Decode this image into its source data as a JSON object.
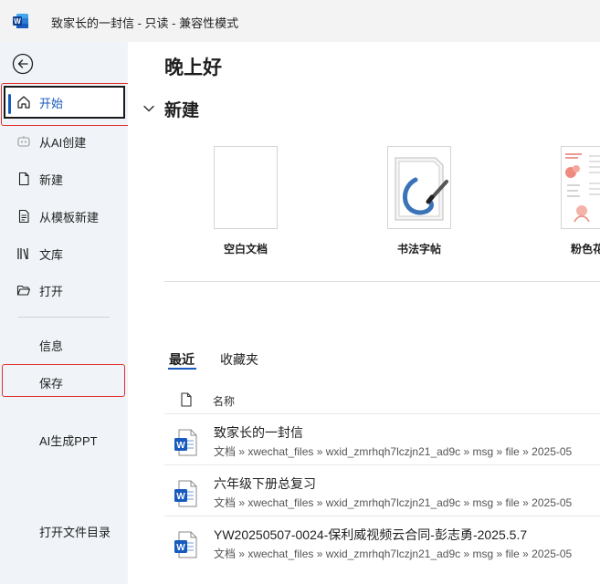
{
  "titlebar": {
    "title": "致家长的一封信  -  只读  -  兼容性模式"
  },
  "sidebar": {
    "items": [
      {
        "label": "开始",
        "icon": "home-icon"
      },
      {
        "label": "从AI创建",
        "icon": "ai-create-icon"
      },
      {
        "label": "新建",
        "icon": "new-document-icon"
      },
      {
        "label": "从模板新建",
        "icon": "template-icon"
      },
      {
        "label": "文库",
        "icon": "library-icon"
      },
      {
        "label": "打开",
        "icon": "folder-open-icon"
      }
    ],
    "info": "信息",
    "save": "保存",
    "ai_ppt": "AI生成PPT",
    "open_dir": "打开文件目录"
  },
  "main": {
    "greeting": "晚上好",
    "new_section": "新建",
    "templates": [
      {
        "label": "空白文档"
      },
      {
        "label": "书法字帖"
      },
      {
        "label": "粉色花卉"
      }
    ],
    "tabs": [
      {
        "label": "最近"
      },
      {
        "label": "收藏夹"
      }
    ],
    "list_header": "名称",
    "files": [
      {
        "name": "致家长的一封信",
        "path": "文档 » xwechat_files » wxid_zmrhqh7lczjn21_ad9c » msg » file » 2025-05"
      },
      {
        "name": "六年级下册总复习",
        "path": "文档 » xwechat_files » wxid_zmrhqh7lczjn21_ad9c » msg » file » 2025-05"
      },
      {
        "name": "YW20250507-0024-保利威视频云合同-彭志勇-2025.5.7",
        "path": "文档 » xwechat_files » wxid_zmrhqh7lczjn21_ad9c » msg » file » 2025-05"
      }
    ]
  },
  "colors": {
    "accent": "#185abd",
    "highlight_box": "#e0302e",
    "sidebar_bg": "#f0f4f8"
  }
}
